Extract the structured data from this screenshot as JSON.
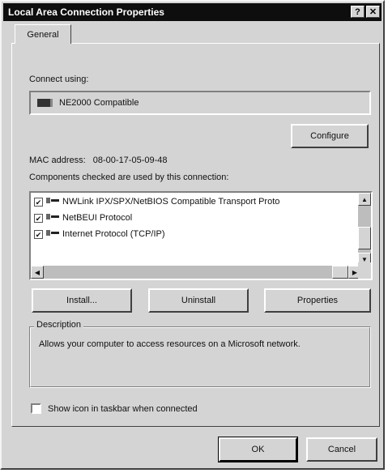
{
  "window": {
    "title": "Local Area Connection Properties",
    "help_label": "?",
    "close_label": "✕"
  },
  "tabs": [
    {
      "label": "General",
      "active": true
    }
  ],
  "connect": {
    "label": "Connect using:",
    "adapter": "NE2000 Compatible",
    "configure_label": "Configure"
  },
  "mac": {
    "label": "MAC address:",
    "value": "08-00-17-05-09-48"
  },
  "components": {
    "label": "Components checked are used by this connection:",
    "items": [
      {
        "label": "NWLink IPX/SPX/NetBIOS Compatible Transport Proto",
        "checked": true
      },
      {
        "label": "NetBEUI Protocol",
        "checked": true
      },
      {
        "label": "Internet Protocol (TCP/IP)",
        "checked": true
      }
    ]
  },
  "buttons": {
    "install": "Install...",
    "uninstall": "Uninstall",
    "properties": "Properties",
    "ok": "OK",
    "cancel": "Cancel"
  },
  "description": {
    "legend": "Description",
    "text": "Allows your computer to access resources on a Microsoft network."
  },
  "taskbar_option": {
    "label": "Show icon in taskbar when connected",
    "checked": false
  }
}
